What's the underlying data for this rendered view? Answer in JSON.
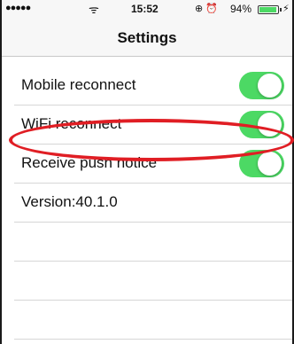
{
  "status_bar": {
    "signal": "●●●●●",
    "wifi_icon": "wifi-icon",
    "time": "15:52",
    "lock_icon": "⊕",
    "alarm_icon": "⏰",
    "battery_text": "94%",
    "battery_level": 0.94,
    "charging_icon": "⚡"
  },
  "nav": {
    "title": "Settings"
  },
  "settings": [
    {
      "label": "Mobile reconnect",
      "toggle_on": true
    },
    {
      "label": "WiFi reconnect",
      "toggle_on": true
    },
    {
      "label": "Receive push notice",
      "toggle_on": true
    }
  ],
  "version": "Version:40.1.0",
  "colors": {
    "toggle_on": "#4cd964",
    "highlight": "#e01e24",
    "bar_bg": "#f7f7f7"
  }
}
